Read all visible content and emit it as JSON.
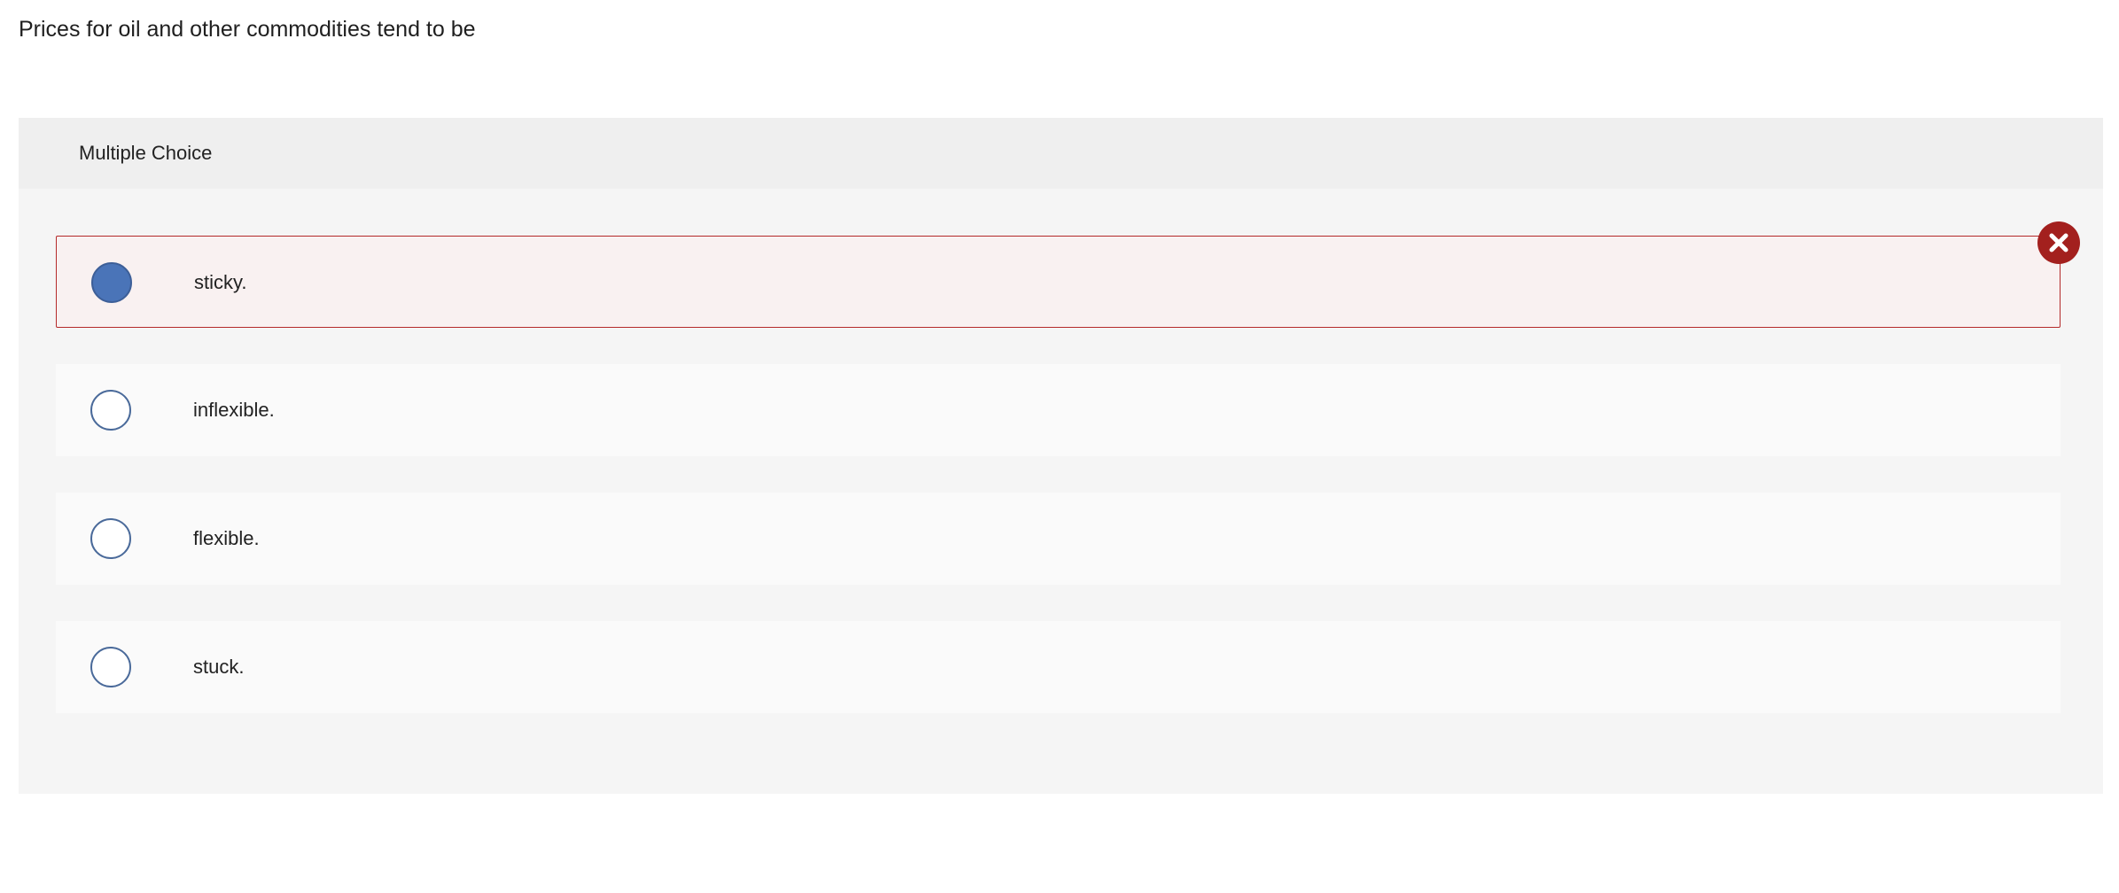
{
  "question": {
    "prompt": "Prices for oil and other commodities tend to be"
  },
  "multiple_choice": {
    "header": "Multiple Choice",
    "options": [
      {
        "label": "sticky.",
        "selected": true,
        "status": "incorrect"
      },
      {
        "label": "inflexible.",
        "selected": false
      },
      {
        "label": "flexible.",
        "selected": false
      },
      {
        "label": "stuck.",
        "selected": false
      }
    ],
    "feedback_icon": "close-x-icon",
    "colors": {
      "incorrect": "#a3201e",
      "selected_radio": "#4a74b8",
      "panel_bg": "#f5f5f5",
      "header_bg": "#efefef"
    }
  }
}
